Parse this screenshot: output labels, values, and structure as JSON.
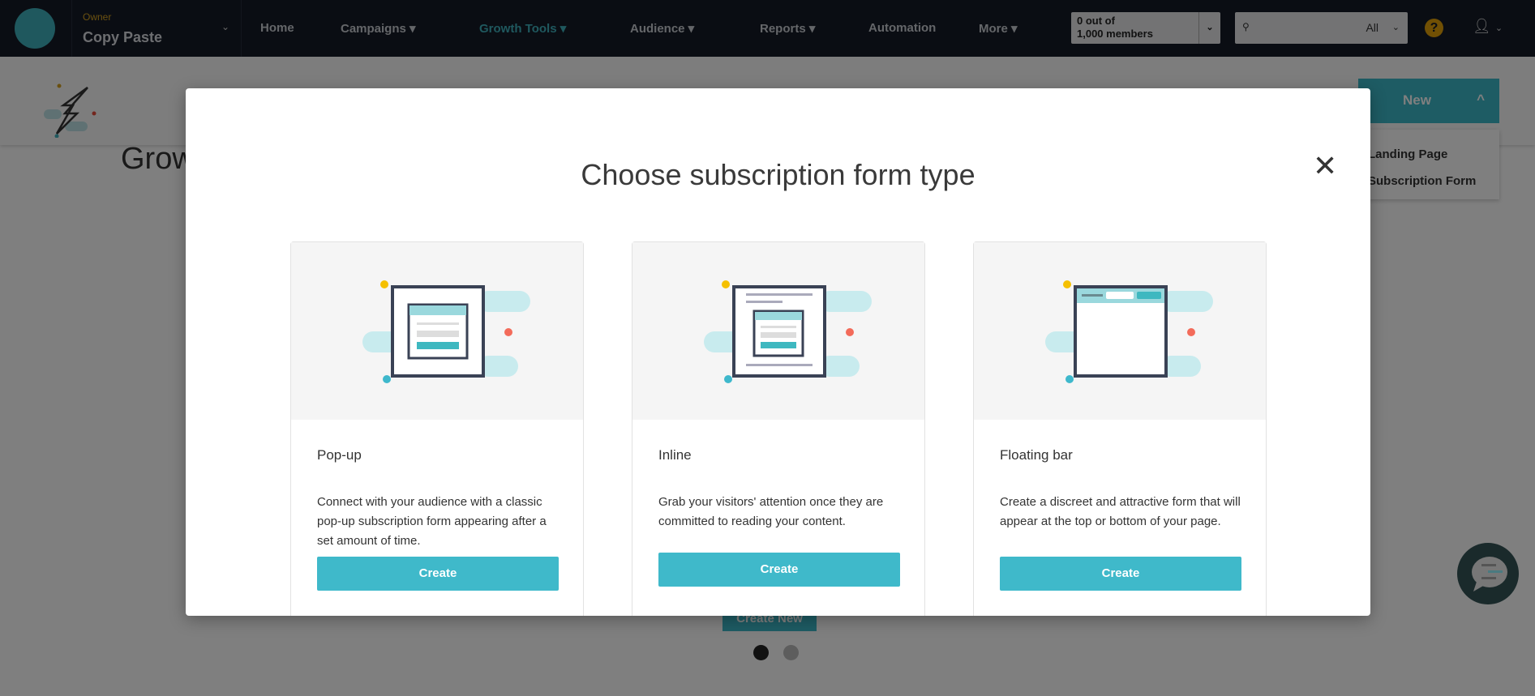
{
  "nav": {
    "account_role": "Owner",
    "account_name": "Copy Paste",
    "items": [
      {
        "label": "Home"
      },
      {
        "label": "Campaigns"
      },
      {
        "label": "Growth Tools",
        "active": true
      },
      {
        "label": "Audience"
      },
      {
        "label": "Reports"
      },
      {
        "label": "Automation"
      },
      {
        "label": "More"
      }
    ],
    "members_line1": "0 out of",
    "members_line2": "1,000 members",
    "search_scope": "All",
    "help": "?"
  },
  "page": {
    "title": "Growth Tools",
    "new_button": "New",
    "new_menu": [
      "Landing Page",
      "Subscription Form"
    ],
    "create_new": "Create New",
    "stat_colors": [
      "#1e2535",
      "#3db8c8",
      "#e3a008",
      "#c0392b"
    ]
  },
  "modal": {
    "title": "Choose subscription form type",
    "cards": [
      {
        "title": "Pop-up",
        "description": "Connect with your audience with a classic pop-up subscription form appearing after a set amount of time.",
        "button": "Create"
      },
      {
        "title": "Inline",
        "description": "Grab your visitors' attention once they are committed to reading your content.",
        "button": "Create"
      },
      {
        "title": "Floating bar",
        "description": "Create a discreet and attractive form that will appear at the top or bottom of your page.",
        "button": "Create"
      }
    ]
  },
  "colors": {
    "accent": "#3fb9ca",
    "nav_bg": "#151b27"
  }
}
